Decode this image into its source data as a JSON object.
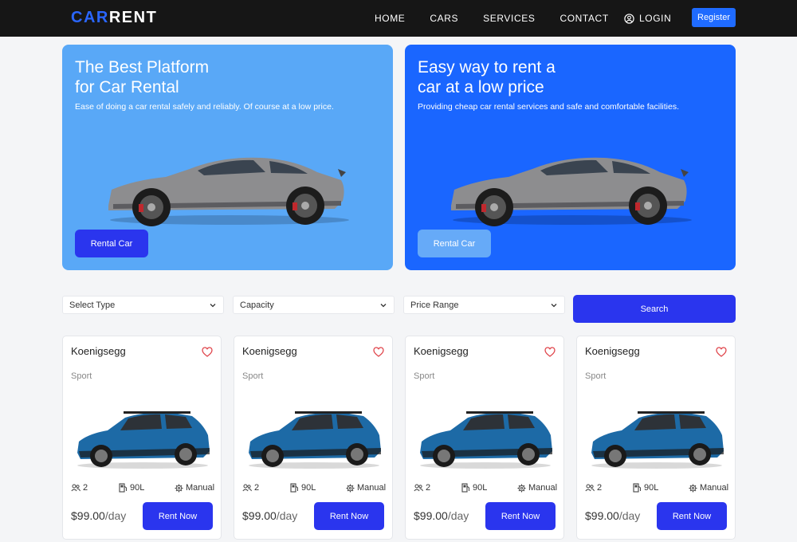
{
  "nav": {
    "logo_part1": "CAR",
    "logo_part2": "RENT",
    "links": [
      "HOME",
      "CARS",
      "SERVICES",
      "CONTACT"
    ],
    "login": "LOGIN",
    "register": "Register"
  },
  "heroes": [
    {
      "title_line1": "The Best Platform",
      "title_line2": "for Car Rental",
      "subtitle": "Ease of doing a car rental safely and reliably. Of course at a low price.",
      "button": "Rental Car"
    },
    {
      "title_line1": "Easy way to rent a",
      "title_line2": "car at a low price",
      "subtitle": "Providing cheap car rental services and safe and comfortable facilities.",
      "button": "Rental Car"
    }
  ],
  "filters": {
    "type": "Select Type",
    "capacity": "Capacity",
    "price": "Price Range",
    "search": "Search"
  },
  "cards": [
    {
      "name": "Koenigsegg",
      "type": "Sport",
      "capacity": "2",
      "fuel": "90L",
      "transmission": "Manual",
      "price": "$99.00",
      "per": "/day",
      "button": "Rent Now"
    },
    {
      "name": "Koenigsegg",
      "type": "Sport",
      "capacity": "2",
      "fuel": "90L",
      "transmission": "Manual",
      "price": "$99.00",
      "per": "/day",
      "button": "Rent Now"
    },
    {
      "name": "Koenigsegg",
      "type": "Sport",
      "capacity": "2",
      "fuel": "90L",
      "transmission": "Manual",
      "price": "$99.00",
      "per": "/day",
      "button": "Rent Now"
    },
    {
      "name": "Koenigsegg",
      "type": "Sport",
      "capacity": "2",
      "fuel": "90L",
      "transmission": "Manual",
      "price": "$99.00",
      "per": "/day",
      "button": "Rent Now"
    }
  ],
  "icons": {
    "login": "user-circle-icon",
    "chevron": "chevron-down-icon",
    "heart": "heart-icon",
    "capacity": "people-icon",
    "fuel": "fuel-pump-icon",
    "transmission": "gear-icon"
  },
  "colors": {
    "nav_bg": "#161616",
    "accent": "#2a35ee",
    "register": "#1f6bff",
    "hero1": "#59a8f7",
    "hero2": "#1a66ff",
    "heart": "#e0454b"
  }
}
